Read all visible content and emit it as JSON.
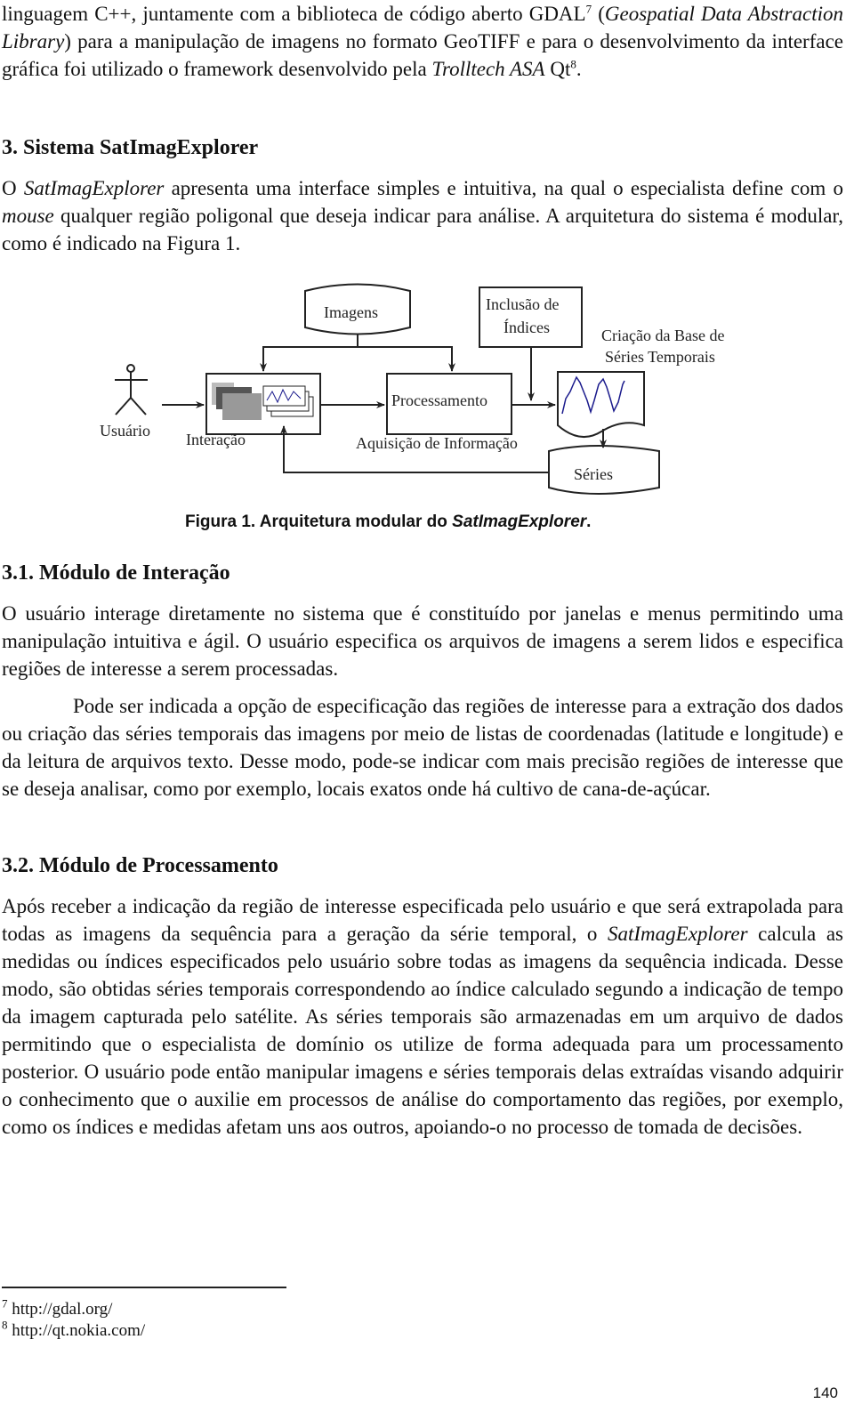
{
  "intro": {
    "text_a": "linguagem C++, juntamente com a biblioteca de código aberto GDAL",
    "fn7": "7",
    "text_b": " (",
    "italic_a": "Geospatial Data Abstraction Library",
    "text_c": ") para a manipulação de imagens no formato GeoTIFF e para o desenvolvimento da interface gráfica foi utilizado o framework desenvolvido pela ",
    "italic_b": "Trolltech ASA",
    "text_d": " Qt",
    "fn8": "8",
    "text_e": "."
  },
  "section3": {
    "heading": "3. Sistema SatImagExplorer",
    "p1_a": "O ",
    "p1_i1": "SatImagExplorer",
    "p1_b": " apresenta uma interface simples e intuitiva, na qual o especialista define com o ",
    "p1_i2": "mouse",
    "p1_c": " qualquer região poligonal que deseja indicar para análise. A arquitetura do sistema é modular, como é indicado na Figura 1."
  },
  "figure": {
    "labels": {
      "imagens": "Imagens",
      "inclusao_l1": "Inclusão de",
      "inclusao_l2": "Índices",
      "criacao_l1": "Criação da Base de",
      "criacao_l2": "Séries Temporais",
      "usuario": "Usuário",
      "interacao": "Interação",
      "processamento": "Processamento",
      "aquisicao": "Aquisição de Informação",
      "series": "Séries"
    },
    "caption_a": "Figura 1. Arquitetura modular do ",
    "caption_i": "SatImagExplorer",
    "caption_b": ".",
    "line_color": "#1a1a8c"
  },
  "section31": {
    "heading": "3.1. Módulo de Interação",
    "p1": "O usuário interage diretamente no sistema que é constituído por janelas e menus permitindo uma manipulação intuitiva e ágil. O usuário especifica os arquivos de imagens a serem lidos e especifica regiões de interesse a serem processadas.",
    "p2": "Pode ser indicada a opção de especificação das regiões de interesse para a extração dos dados ou criação das séries temporais das imagens por meio de listas de coordenadas (latitude e longitude) e da leitura de arquivos texto. Desse modo, pode-se indicar com mais precisão regiões de interesse que se deseja analisar, como por exemplo, locais exatos onde há cultivo de cana-de-açúcar."
  },
  "section32": {
    "heading": "3.2. Módulo de Processamento",
    "p1_a": "Após receber a indicação da região de interesse especificada pelo usuário e que será extrapolada para todas as imagens da sequência para a geração da série temporal, o ",
    "p1_i": "SatImagExplorer",
    "p1_b": " calcula as medidas ou índices especificados pelo usuário sobre todas as imagens da sequência indicada. Desse modo, são obtidas séries temporais correspondendo ao índice calculado segundo a indicação de tempo da imagem capturada pelo satélite. As séries temporais são armazenadas em um arquivo de dados permitindo que o especialista de domínio os utilize de forma adequada para um processamento posterior. O usuário pode então manipular imagens e séries temporais delas extraídas visando adquirir o conhecimento que o auxilie em processos de análise do comportamento das regiões, por exemplo, como os índices e medidas afetam uns aos outros, apoiando-o no processo de tomada de decisões."
  },
  "footnotes": [
    {
      "num": "7",
      "text": " http://gdal.org/"
    },
    {
      "num": "8",
      "text": " http://qt.nokia.com/"
    }
  ],
  "page_number": "140"
}
